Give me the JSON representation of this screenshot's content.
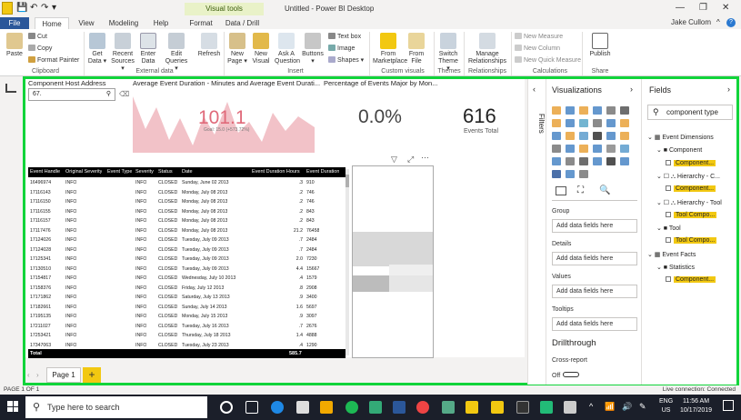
{
  "window": {
    "title": "Untitled - Power BI Desktop",
    "contextual_tab": "Visual tools",
    "user": "Jake Cullom",
    "min_glyph": "—",
    "max_glyph": "❐",
    "close_glyph": "✕"
  },
  "tabs": [
    "File",
    "Home",
    "View",
    "Modeling",
    "Help",
    "Format",
    "Data / Drill"
  ],
  "ribbon": {
    "clipboard": {
      "paste": "Paste",
      "cut": "Cut",
      "copy": "Copy",
      "format_painter": "Format Painter",
      "group": "Clipboard"
    },
    "external_data": {
      "get_data": "Get Data ▾",
      "recent_sources": "Recent Sources ▾",
      "enter_data": "Enter Data",
      "edit_queries": "Edit Queries ▾",
      "refresh": "Refresh",
      "group": "External data"
    },
    "insert": {
      "new_page": "New Page ▾",
      "new_visual": "New Visual",
      "ask_question": "Ask A Question",
      "buttons": "Buttons ▾",
      "text_box": "Text box",
      "image": "Image",
      "shapes": "Shapes ▾",
      "group": "Insert"
    },
    "custom_visuals": {
      "from_marketplace": "From Marketplace",
      "from_file": "From File",
      "group": "Custom visuals"
    },
    "themes": {
      "switch_theme": "Switch Theme ▾",
      "group": "Themes"
    },
    "relationships": {
      "manage": "Manage Relationships",
      "group": "Relationships"
    },
    "calculations": {
      "new_measure": "New Measure",
      "new_column": "New Column",
      "new_quick_measure": "New Quick Measure",
      "group": "Calculations"
    },
    "share": {
      "publish": "Publish",
      "group": "Share"
    }
  },
  "visuals": {
    "slicer_title": "Component Host Address",
    "slicer_value": "67.",
    "kpi_title": "Average Event Duration - Minutes and Average Event Durati...",
    "kpi_value": "101.1",
    "kpi_goal": "Goal: 15.0 (+573.72%)",
    "gauge_title": "Percentage of Events Major by Mon...",
    "pct_value": "0.0%",
    "card_value": "616",
    "card_label": "Events Total"
  },
  "table": {
    "columns": [
      "Event Handle",
      "Original Severity",
      "Event Type",
      "Severity",
      "Status",
      "Date",
      "Event Duration Hours",
      "Event Duration"
    ],
    "rows": [
      [
        "16496974",
        "INFO",
        "",
        "INFO",
        "CLOSED",
        "Sunday, June 02 2013",
        ".3",
        "910"
      ],
      [
        "17116143",
        "INFO",
        "",
        "INFO",
        "CLOSED",
        "Monday, July 08 2013",
        ".2",
        "746"
      ],
      [
        "17116150",
        "INFO",
        "",
        "INFO",
        "CLOSED",
        "Monday, July 08 2013",
        ".2",
        "746"
      ],
      [
        "17116155",
        "INFO",
        "",
        "INFO",
        "CLOSED",
        "Monday, July 08 2013",
        ".2",
        "843"
      ],
      [
        "17116157",
        "INFO",
        "",
        "INFO",
        "CLOSED",
        "Monday, July 08 2013",
        ".2",
        "843"
      ],
      [
        "17117476",
        "INFO",
        "",
        "INFO",
        "CLOSED",
        "Monday, July 08 2013",
        "21.2",
        "76458"
      ],
      [
        "17124026",
        "INFO",
        "",
        "INFO",
        "CLOSED",
        "Tuesday, July 09 2013",
        ".7",
        "2484"
      ],
      [
        "17124028",
        "INFO",
        "",
        "INFO",
        "CLOSED",
        "Tuesday, July 09 2013",
        ".7",
        "2484"
      ],
      [
        "17125341",
        "INFO",
        "",
        "INFO",
        "CLOSED",
        "Tuesday, July 09 2013",
        "2.0",
        "7230"
      ],
      [
        "17130510",
        "INFO",
        "",
        "INFO",
        "CLOSED",
        "Tuesday, July 09 2013",
        "4.4",
        "15667"
      ],
      [
        "17154817",
        "INFO",
        "",
        "INFO",
        "CLOSED",
        "Wednesday, July 10 2013",
        ".4",
        "1579"
      ],
      [
        "17158376",
        "INFO",
        "",
        "INFO",
        "CLOSED",
        "Friday, July 12 2013",
        ".8",
        "2908"
      ],
      [
        "17171862",
        "INFO",
        "",
        "INFO",
        "CLOSED",
        "Saturday, July 13 2013",
        ".9",
        "3400"
      ],
      [
        "17182661",
        "INFO",
        "",
        "INFO",
        "CLOSED",
        "Sunday, July 14 2013",
        "1.6",
        "5697"
      ],
      [
        "17195135",
        "INFO",
        "",
        "INFO",
        "CLOSED",
        "Monday, July 15 2013",
        ".9",
        "3097"
      ],
      [
        "17211027",
        "INFO",
        "",
        "INFO",
        "CLOSED",
        "Tuesday, July 16 2013",
        ".7",
        "2676"
      ],
      [
        "17253421",
        "INFO",
        "",
        "INFO",
        "CLOSED",
        "Thursday, July 18 2013",
        "1.4",
        "4888"
      ],
      [
        "17347063",
        "INFO",
        "",
        "INFO",
        "CLOSED",
        "Tuesday, July 23 2013",
        ".4",
        "1290"
      ]
    ],
    "total_label": "Total",
    "total_hours": "585.7"
  },
  "pages": {
    "page1": "Page 1",
    "add": "+"
  },
  "status": {
    "page_count": "PAGE 1 OF 1",
    "connection": "Live connection: Connected"
  },
  "filters_label": "Filters",
  "visualizations": {
    "title": "Visualizations",
    "wells": [
      {
        "label": "Group",
        "placeholder": "Add data fields here"
      },
      {
        "label": "Details",
        "placeholder": "Add data fields here"
      },
      {
        "label": "Values",
        "placeholder": "Add data fields here"
      },
      {
        "label": "Tooltips",
        "placeholder": "Add data fields here"
      }
    ],
    "drillthrough": "Drillthrough",
    "cross_report": "Cross-report",
    "off": "Off"
  },
  "fields": {
    "title": "Fields",
    "search": "component type",
    "tree": [
      {
        "label": "Event Dimensions",
        "level": 0,
        "kind": "table",
        "highlight": false
      },
      {
        "label": "Component",
        "level": 1,
        "kind": "folder",
        "highlight": false
      },
      {
        "label": "Component...",
        "level": 2,
        "kind": "field",
        "highlight": true
      },
      {
        "label": "Hierarchy - C...",
        "level": 1,
        "kind": "hierarchy",
        "highlight": false
      },
      {
        "label": "Component...",
        "level": 2,
        "kind": "field",
        "highlight": true
      },
      {
        "label": "Hierarchy - Tool",
        "level": 1,
        "kind": "hierarchy",
        "highlight": false
      },
      {
        "label": "Tool Compo...",
        "level": 2,
        "kind": "field",
        "highlight": true
      },
      {
        "label": "Tool",
        "level": 1,
        "kind": "folder",
        "highlight": false
      },
      {
        "label": "Tool Compo...",
        "level": 2,
        "kind": "field",
        "highlight": true
      },
      {
        "label": "Event Facts",
        "level": 0,
        "kind": "table",
        "highlight": false
      },
      {
        "label": "Statistics",
        "level": 1,
        "kind": "folder",
        "highlight": false
      },
      {
        "label": "Component...",
        "level": 2,
        "kind": "field",
        "highlight": true
      }
    ]
  },
  "taskbar": {
    "search": "Type here to search",
    "time": "11:56 AM",
    "date": "10/17/2019",
    "lang1": "ENG",
    "lang2": "US"
  },
  "colors": {
    "accent": "#11d43a",
    "kpi_red": "#e06a7a",
    "brand_yellow": "#f2c811",
    "file_tab": "#2b579a"
  }
}
